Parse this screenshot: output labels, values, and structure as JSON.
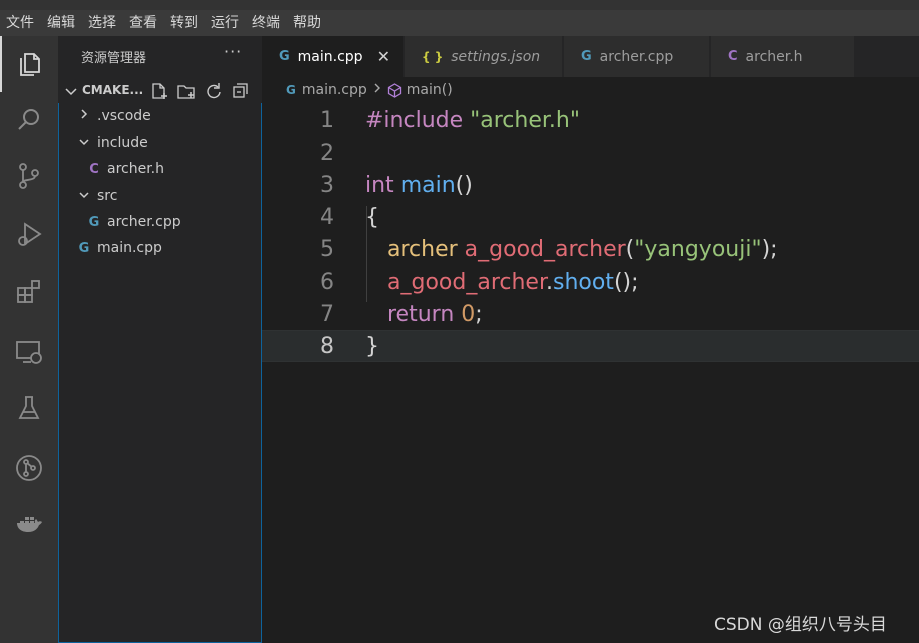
{
  "menu": [
    "文件",
    "编辑",
    "选择",
    "查看",
    "转到",
    "运行",
    "终端",
    "帮助"
  ],
  "activity_bar": [
    "files-icon",
    "search-icon",
    "source-control-icon",
    "run-debug-icon",
    "extensions-icon",
    "remote-explorer-icon",
    "testing-icon",
    "git-graph-icon",
    "docker-icon"
  ],
  "sidebar": {
    "title": "资源管理器",
    "more": "···",
    "project": "CMAKE...",
    "tree": [
      {
        "label": ".vscode",
        "kind": "folder",
        "expanded": false,
        "depth": 1
      },
      {
        "label": "include",
        "kind": "folder",
        "expanded": true,
        "depth": 1
      },
      {
        "label": "archer.h",
        "kind": "h",
        "depth": 2
      },
      {
        "label": "src",
        "kind": "folder",
        "expanded": true,
        "depth": 1
      },
      {
        "label": "archer.cpp",
        "kind": "cpp",
        "depth": 2
      },
      {
        "label": "main.cpp",
        "kind": "cpp",
        "depth": 1
      }
    ]
  },
  "tabs": [
    {
      "label": "main.cpp",
      "icon": "G",
      "active": true,
      "close": "✕"
    },
    {
      "label": "settings.json",
      "icon": "{ }",
      "active": false
    },
    {
      "label": "archer.cpp",
      "icon": "G",
      "active": false
    },
    {
      "label": "archer.h",
      "icon": "C",
      "active": false
    }
  ],
  "breadcrumb": {
    "file": "main.cpp",
    "symbol": "main()"
  },
  "editor": {
    "line_numbers": [
      "1",
      "2",
      "3",
      "4",
      "5",
      "6",
      "7",
      "8"
    ],
    "current_line": 8,
    "tokens": {
      "l1_directive": "#include",
      "l1_space": " ",
      "l1_string": "\"archer.h\"",
      "l3_int": "int",
      "l3_main": "main",
      "l3_parens": "()",
      "l4_open": "{",
      "l5_type": "archer",
      "l5_var": "a_good_archer",
      "l5_open": "(",
      "l5_str": "\"yangyouji\"",
      "l5_close": ")",
      "l5_semi": ";",
      "l6_var": "a_good_archer",
      "l6_dot": ".",
      "l6_fn": "shoot",
      "l6_parens": "()",
      "l6_semi": ";",
      "l7_return": "return",
      "l7_zero": "0",
      "l7_semi": ";",
      "l8_close": "}"
    }
  },
  "watermark": "CSDN @组织八号头目",
  "colors": {
    "accent": "#0e639c",
    "cpp_icon": "#519aba",
    "h_icon": "#a074c4",
    "json_icon": "#cbcb41"
  }
}
